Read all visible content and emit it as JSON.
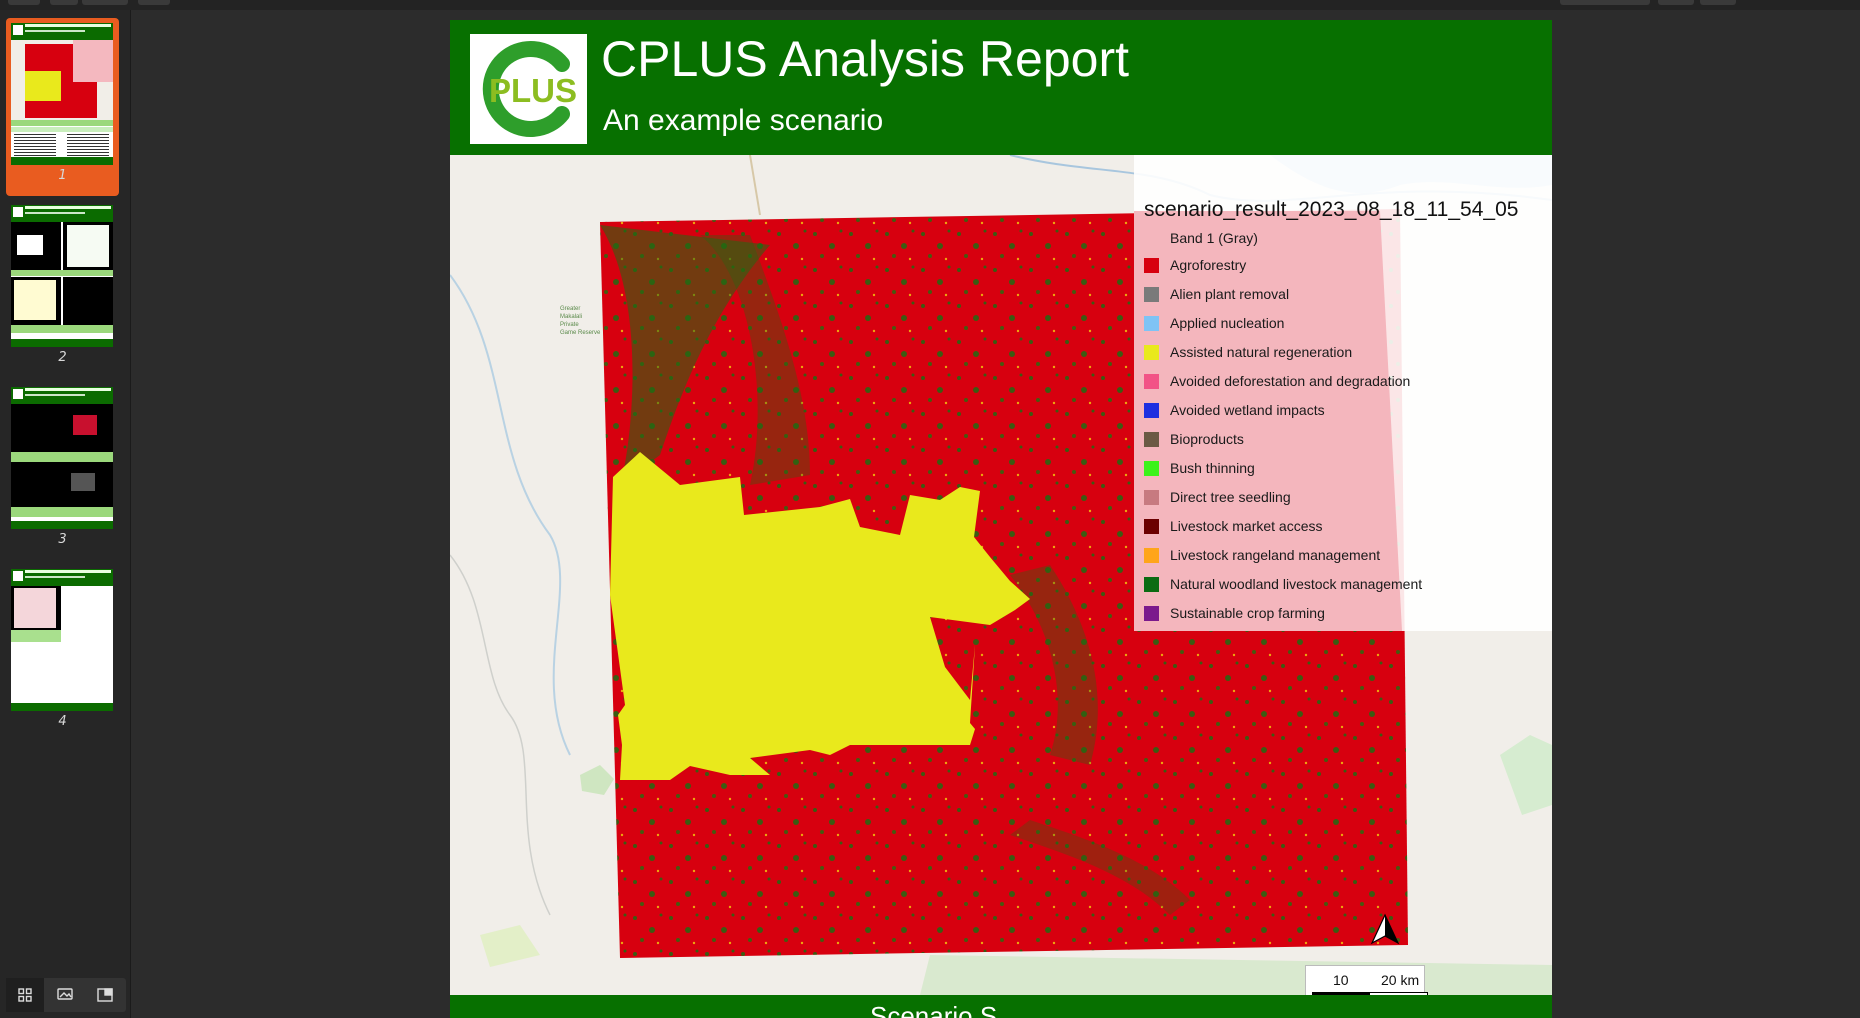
{
  "viewer": {
    "pages": [
      {
        "number": "1"
      },
      {
        "number": "2"
      },
      {
        "number": "3"
      },
      {
        "number": "4"
      }
    ],
    "active_page": "1"
  },
  "report": {
    "title": "CPLUS Analysis Report",
    "subtitle": "An example scenario",
    "logo_text": "PLUS",
    "footer_text": "Scenario S"
  },
  "legend": {
    "title": "scenario_result_2023_08_18_11_54_05",
    "items": [
      {
        "label": "Band 1 (Gray)",
        "color": ""
      },
      {
        "label": "Agroforestry",
        "color": "#d7000f"
      },
      {
        "label": "Alien plant removal",
        "color": "#7a7a7a"
      },
      {
        "label": "Applied nucleation",
        "color": "#7fc3f5"
      },
      {
        "label": "Assisted natural regeneration",
        "color": "#e9e91c"
      },
      {
        "label": "Avoided deforestation and degradation",
        "color": "#f25386"
      },
      {
        "label": "Avoided wetland impacts",
        "color": "#1e2fe0"
      },
      {
        "label": "Bioproducts",
        "color": "#6b5a44"
      },
      {
        "label": "Bush thinning",
        "color": "#3cf21a"
      },
      {
        "label": "Direct tree seedling",
        "color": "#c77a80"
      },
      {
        "label": "Livestock market access",
        "color": "#6b0000"
      },
      {
        "label": "Livestock rangeland management",
        "color": "#ffa51a"
      },
      {
        "label": "Natural woodland livestock management",
        "color": "#0c6b12"
      },
      {
        "label": "Sustainable crop farming",
        "color": "#7b1a8c"
      }
    ]
  },
  "scalebar": {
    "label_mid": "10",
    "label_end": "20 km"
  },
  "colors": {
    "brand_green": "#077000",
    "active_thumb": "#e95c20"
  }
}
